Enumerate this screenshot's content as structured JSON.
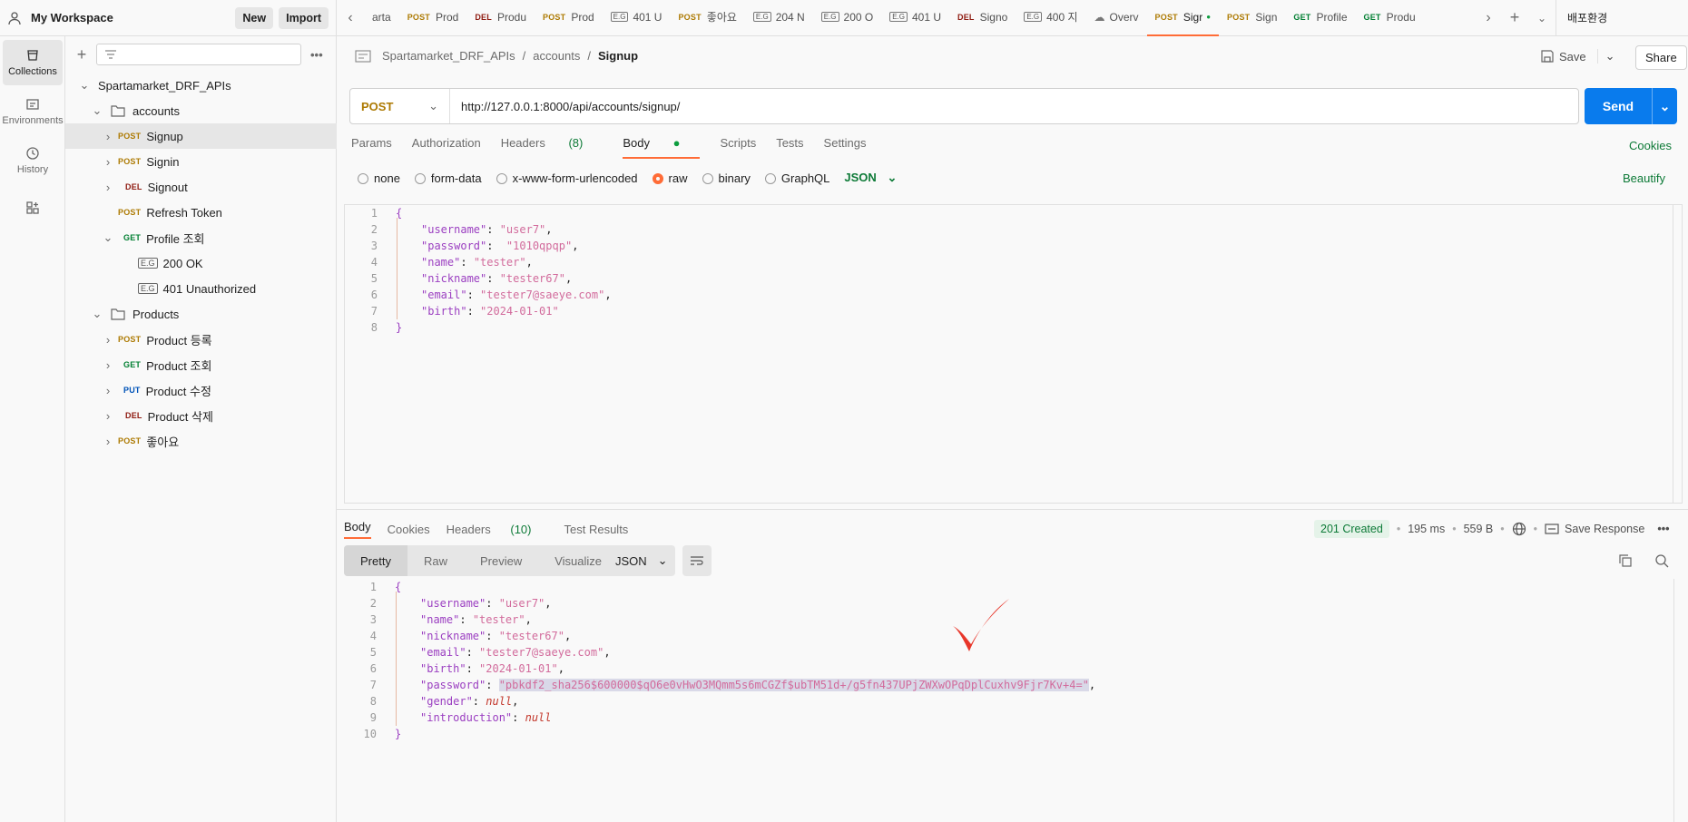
{
  "workspace": {
    "name": "My Workspace",
    "new_label": "New",
    "import_label": "Import"
  },
  "rail": [
    {
      "label": "Collections",
      "icon": "collections-icon"
    },
    {
      "label": "Environments",
      "icon": "environments-icon"
    },
    {
      "label": "History",
      "icon": "history-icon"
    },
    {
      "label": "",
      "icon": "apps-icon"
    }
  ],
  "tree": {
    "root": "Spartamarket_DRF_APIs",
    "folder_accounts": "accounts",
    "signup": {
      "method": "POST",
      "label": "Signup"
    },
    "signin": {
      "method": "POST",
      "label": "Signin"
    },
    "signout": {
      "method": "DEL",
      "label": "Signout"
    },
    "refresh": {
      "method": "POST",
      "label": "Refresh Token"
    },
    "profile": {
      "method": "GET",
      "label": "Profile 조회"
    },
    "ex200": "200 OK",
    "ex401": "401 Unauthorized",
    "folder_products": "Products",
    "p_reg": {
      "method": "POST",
      "label": "Product 등록"
    },
    "p_get": {
      "method": "GET",
      "label": "Product 조회"
    },
    "p_put": {
      "method": "PUT",
      "label": "Product 수정"
    },
    "p_del": {
      "method": "DEL",
      "label": "Product 삭제"
    },
    "like": {
      "method": "POST",
      "label": "좋아요"
    }
  },
  "tabs": [
    {
      "method": "",
      "label": "arta"
    },
    {
      "method": "POST",
      "label": "Prod"
    },
    {
      "method": "DEL",
      "label": "Produ"
    },
    {
      "method": "POST",
      "label": "Prod"
    },
    {
      "method": "EX",
      "label": "401 U"
    },
    {
      "method": "POST",
      "label": "좋아요"
    },
    {
      "method": "EX",
      "label": "204 N"
    },
    {
      "method": "EX",
      "label": "200 O"
    },
    {
      "method": "EX",
      "label": "401 U"
    },
    {
      "method": "DEL",
      "label": "Signo"
    },
    {
      "method": "EX",
      "label": "400 지"
    },
    {
      "method": "OV",
      "label": "Overv"
    },
    {
      "method": "POST",
      "label": "Sigr"
    },
    {
      "method": "POST",
      "label": "Sign"
    },
    {
      "method": "GET",
      "label": "Profile"
    },
    {
      "method": "GET",
      "label": "Produ"
    }
  ],
  "environment": "배포환경",
  "breadcrumb": {
    "root": "Spartamarket_DRF_APIs",
    "folder": "accounts",
    "current": "Signup"
  },
  "toolbar": {
    "save_label": "Save",
    "share_label": "Share"
  },
  "request": {
    "method": "POST",
    "url": "http://127.0.0.1:8000/api/accounts/signup/",
    "send_label": "Send"
  },
  "req_tabs": {
    "params": "Params",
    "auth": "Authorization",
    "headers": "Headers",
    "headers_count": "(8)",
    "body": "Body",
    "scripts": "Scripts",
    "tests": "Tests",
    "settings": "Settings",
    "cookies": "Cookies"
  },
  "body_types": {
    "none": "none",
    "form_data": "form-data",
    "urlencoded": "x-www-form-urlencoded",
    "raw": "raw",
    "binary": "binary",
    "graphql": "GraphQL",
    "lang": "JSON",
    "beautify": "Beautify"
  },
  "request_body": [
    {
      "n": "1",
      "t": "{"
    },
    {
      "n": "2",
      "k": "\"username\"",
      "v": "\"user7\""
    },
    {
      "n": "3",
      "k": "\"password\"",
      "v": " \"1010qpqp\""
    },
    {
      "n": "4",
      "k": "\"name\"",
      "v": "\"tester\""
    },
    {
      "n": "5",
      "k": "\"nickname\"",
      "v": "\"tester67\""
    },
    {
      "n": "6",
      "k": "\"email\"",
      "v": "\"tester7@saeye.com\""
    },
    {
      "n": "7",
      "k": "\"birth\"",
      "v": "\"2024-01-01\"",
      "last": true
    },
    {
      "n": "8",
      "t": "}"
    }
  ],
  "response": {
    "tabs": {
      "body": "Body",
      "cookies": "Cookies",
      "headers": "Headers",
      "headers_count": "(10)",
      "tests": "Test Results"
    },
    "status": "201 Created",
    "time": "195 ms",
    "size": "559 B",
    "save_label": "Save Response",
    "views": {
      "pretty": "Pretty",
      "raw": "Raw",
      "preview": "Preview",
      "visualize": "Visualize",
      "format": "JSON"
    }
  },
  "response_body": [
    {
      "n": "1",
      "t": "{"
    },
    {
      "n": "2",
      "k": "\"username\"",
      "v": "\"user7\""
    },
    {
      "n": "3",
      "k": "\"name\"",
      "v": "\"tester\""
    },
    {
      "n": "4",
      "k": "\"nickname\"",
      "v": "\"tester67\""
    },
    {
      "n": "5",
      "k": "\"email\"",
      "v": "\"tester7@saeye.com\""
    },
    {
      "n": "6",
      "k": "\"birth\"",
      "v": "\"2024-01-01\""
    },
    {
      "n": "7",
      "k": "\"password\"",
      "v": "\"pbkdf2_sha256$600000$qO6e0vHwO3MQmm5s6mCGZf$ubTM51d+/g5fn437UPjZWXwOPqDplCuxhv9Fjr7Kv+4=\"",
      "hl": true
    },
    {
      "n": "8",
      "k": "\"gender\"",
      "v": "null"
    },
    {
      "n": "9",
      "k": "\"introduction\"",
      "v": "null",
      "last": true
    },
    {
      "n": "10",
      "t": "}"
    }
  ],
  "colors": {
    "accent": "#ff6c37",
    "send": "#097bed",
    "annotation": "#e8362a"
  }
}
